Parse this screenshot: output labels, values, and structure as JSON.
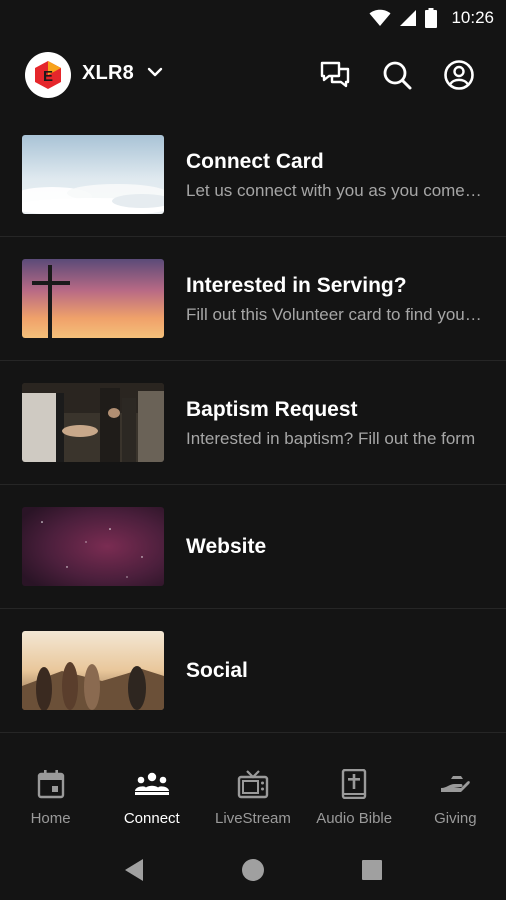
{
  "status_bar": {
    "time": "10:26"
  },
  "header": {
    "logo_letter": "E",
    "org_name": "XLR8",
    "accent": "#e5262b"
  },
  "items": [
    {
      "title": "Connect Card",
      "subtitle": "Let us connect with you as you come to church",
      "image": "sky-clouds"
    },
    {
      "title": "Interested in Serving?",
      "subtitle": "Fill out this Volunteer card to find your place",
      "image": "cross-sunset"
    },
    {
      "title": "Baptism Request",
      "subtitle": "Interested in baptism?  Fill out the form",
      "image": "worship-hands"
    },
    {
      "title": "Website",
      "subtitle": "",
      "image": "night-sky"
    },
    {
      "title": "Social",
      "subtitle": "",
      "image": "friends-sunset"
    }
  ],
  "tabs": [
    {
      "label": "Home",
      "icon": "calendar-icon",
      "active": false
    },
    {
      "label": "Connect",
      "icon": "group-icon",
      "active": true
    },
    {
      "label": "LiveStream",
      "icon": "tv-icon",
      "active": false
    },
    {
      "label": "Audio Bible",
      "icon": "bible-icon",
      "active": false
    },
    {
      "label": "Giving",
      "icon": "giving-hand-icon",
      "active": false
    }
  ]
}
